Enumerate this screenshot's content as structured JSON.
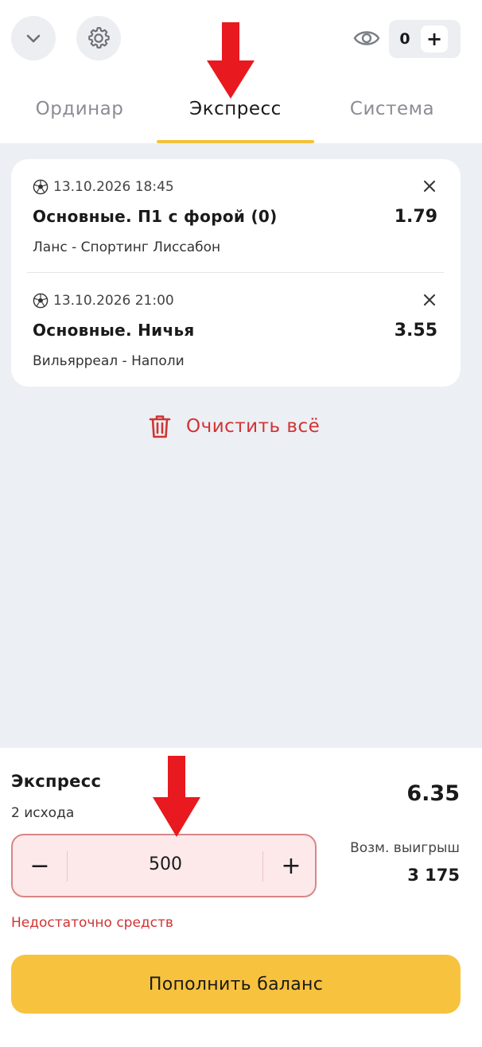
{
  "header": {
    "collapse_icon": "chevron-down-icon",
    "settings_icon": "gear-icon",
    "visibility_icon": "eye-icon",
    "counter_value": "0",
    "counter_add": "+"
  },
  "tabs": [
    {
      "label": "Ординар",
      "active": false
    },
    {
      "label": "Экспресс",
      "active": true
    },
    {
      "label": "Система",
      "active": false
    }
  ],
  "bets": [
    {
      "sport_icon": "soccer-ball-icon",
      "datetime": "13.10.2026 18:45",
      "market": "Основные. П1 с форой (0)",
      "odds": "1.79",
      "teams": "Ланс - Спортинг Лиссабон"
    },
    {
      "sport_icon": "soccer-ball-icon",
      "datetime": "13.10.2026 21:00",
      "market": "Основные. Ничья",
      "odds": "3.55",
      "teams": "Вильярреал - Наполи"
    }
  ],
  "clear_all": {
    "icon": "trash-icon",
    "label": "Очистить всё"
  },
  "slip": {
    "title": "Экспресс",
    "outcomes": "2 исхода",
    "total_odds": "6.35",
    "stake_minus": "−",
    "stake_value": "500",
    "stake_plus": "+",
    "potential_win_label": "Возм. выигрыш",
    "potential_win_value": "3 175",
    "error": "Недостаточно средств",
    "topup_label": "Пополнить баланс"
  },
  "colors": {
    "accent_yellow": "#f7c23e",
    "error_red": "#d03434",
    "annotation_arrow": "#e8191f"
  }
}
